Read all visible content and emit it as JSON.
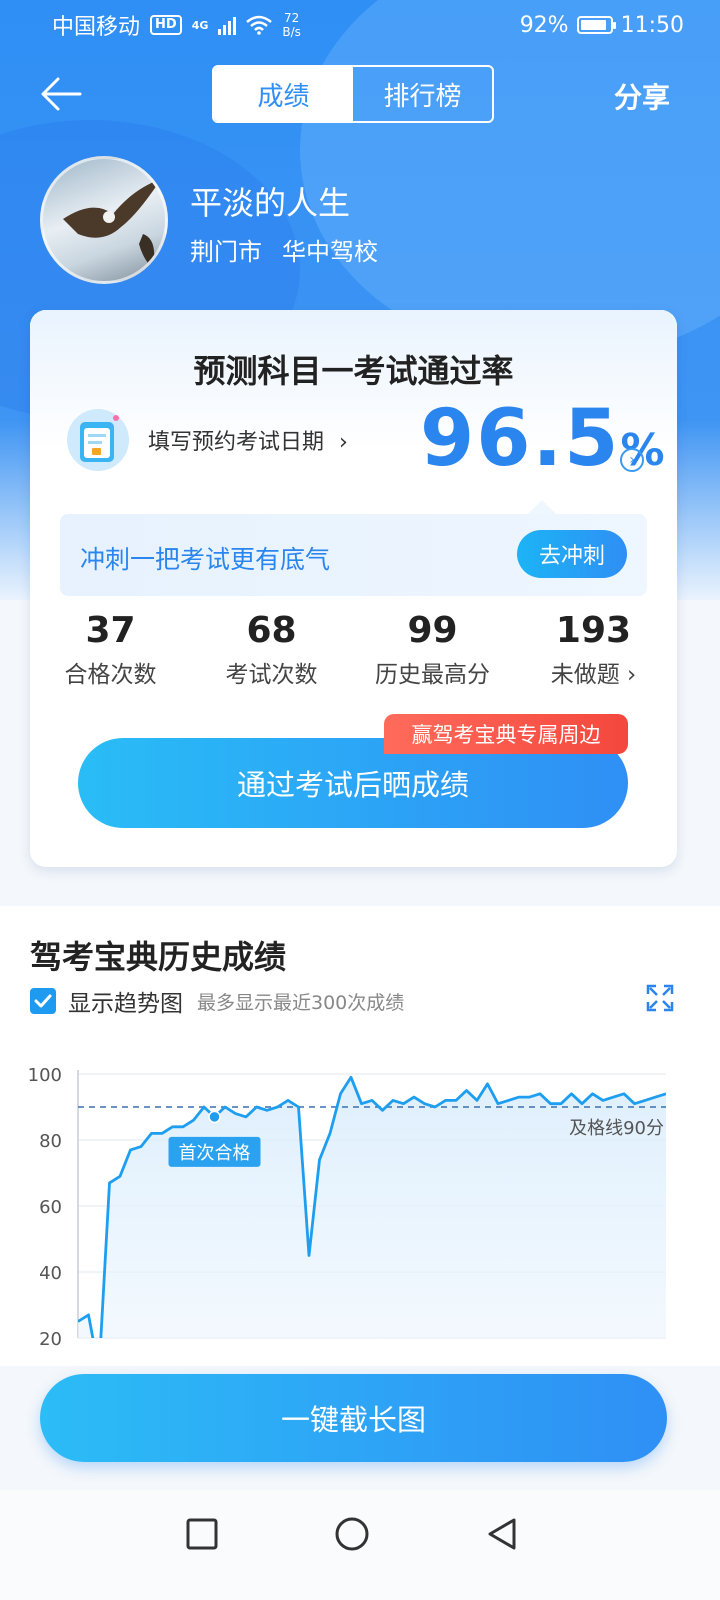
{
  "status_bar": {
    "carrier": "中国移动",
    "hd": "HD",
    "network": "4G",
    "net_speed_value": "72",
    "net_speed_unit": "B/s",
    "battery": "92%",
    "battery_level": 0.92,
    "time": "11:50"
  },
  "nav": {
    "tab_score": "成绩",
    "tab_rank": "排行榜",
    "share": "分享"
  },
  "profile": {
    "name": "平淡的人生",
    "city": "荆门市",
    "school": "华中驾校"
  },
  "card": {
    "title": "预测科目一考试通过率",
    "fill_date": "填写预约考试日期",
    "fill_date_arrow": "›",
    "pass_rate": "96.5",
    "pass_rate_unit": "%",
    "rate_arrow": "›",
    "sprint_text": "冲刺一把考试更有底气",
    "sprint_button": "去冲刺",
    "stats": [
      {
        "value": "37",
        "label": "合格次数"
      },
      {
        "value": "68",
        "label": "考试次数"
      },
      {
        "value": "99",
        "label": "历史最高分"
      },
      {
        "value": "193",
        "label": "未做题 ›"
      }
    ],
    "promo_tag": "赢驾考宝典专属周边",
    "share_button": "通过考试后晒成绩"
  },
  "history": {
    "title": "驾考宝典历史成绩",
    "show_trend": "显示趋势图",
    "trend_hint": "最多显示最近300次成绩"
  },
  "chart_data": {
    "type": "line",
    "ylim": [
      20,
      100
    ],
    "y_ticks": [
      "100",
      "80",
      "60",
      "40",
      "20"
    ],
    "pass_line_value": 90,
    "pass_line_label": "及格线90分",
    "first_pass_label": "首次合格",
    "first_pass_index": 13,
    "grid": true,
    "values": [
      25,
      27,
      10,
      67,
      69,
      77,
      78,
      82,
      82,
      84,
      84,
      86,
      90,
      87,
      90,
      88,
      87,
      90,
      89,
      90,
      92,
      90,
      45,
      74,
      82,
      94,
      99,
      91,
      92,
      89,
      92,
      91,
      93,
      91,
      90,
      92,
      92,
      95,
      92,
      97,
      91,
      92,
      93,
      93,
      94,
      91,
      91,
      94,
      91,
      94,
      92,
      93,
      94,
      91,
      92,
      93,
      94
    ]
  },
  "bottom": {
    "long_shot_button": "一键截长图"
  }
}
